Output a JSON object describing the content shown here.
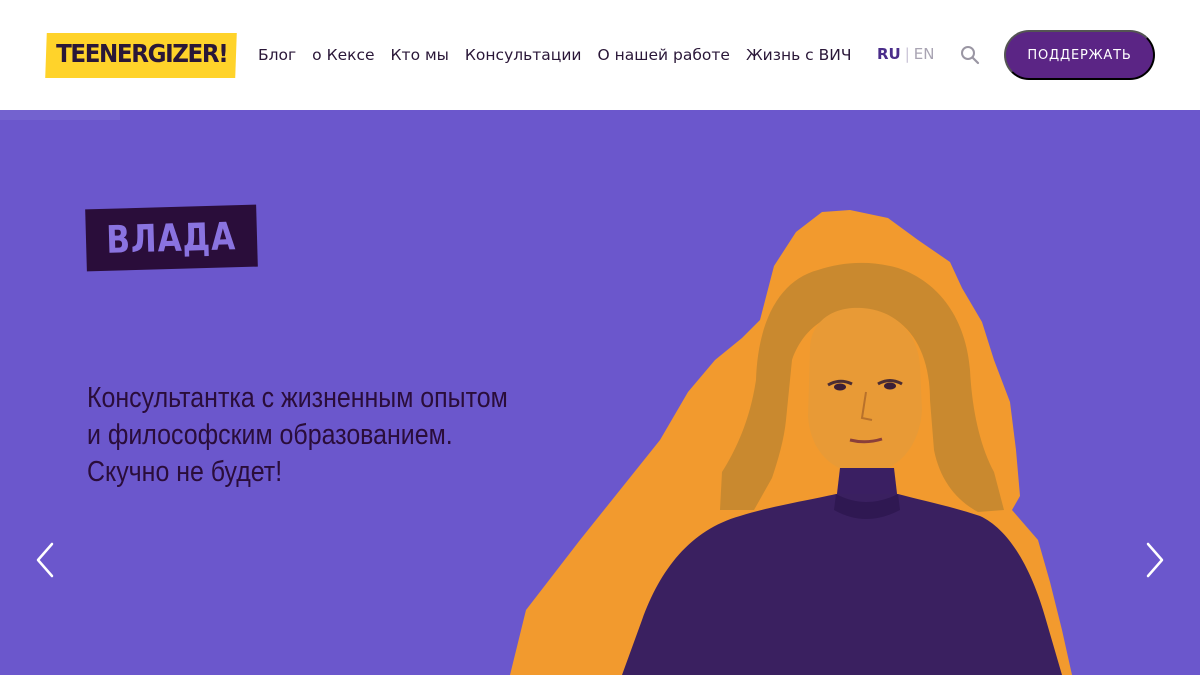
{
  "header": {
    "logo_text": "TEENERGIZER!",
    "nav": [
      {
        "label": "Блог"
      },
      {
        "label": "о Кексе"
      },
      {
        "label": "Кто мы"
      },
      {
        "label": "Консультации",
        "active": true
      },
      {
        "label": "О нашей работе"
      },
      {
        "label": "Жизнь с ВИЧ"
      }
    ],
    "lang": {
      "ru": "RU",
      "separator": "|",
      "en": "EN",
      "active": "RU"
    },
    "search_icon": "search-icon",
    "support_label": "ПОДДЕРЖАТЬ"
  },
  "hero": {
    "name": "ВЛАДА",
    "tagline": [
      "Консультантка с жизненным опытом",
      "и философским образованием.",
      "Скучно не будет!"
    ],
    "slide_progress": 0.1,
    "prev_icon": "chevron-left-icon",
    "next_icon": "chevron-right-icon"
  },
  "colors": {
    "brand_yellow": "#ffd32a",
    "brand_purple": "#5b2585",
    "hero_background": "#6b57cc",
    "dark_text": "#2a0d3a",
    "photo_outline": "#f29a2e"
  }
}
